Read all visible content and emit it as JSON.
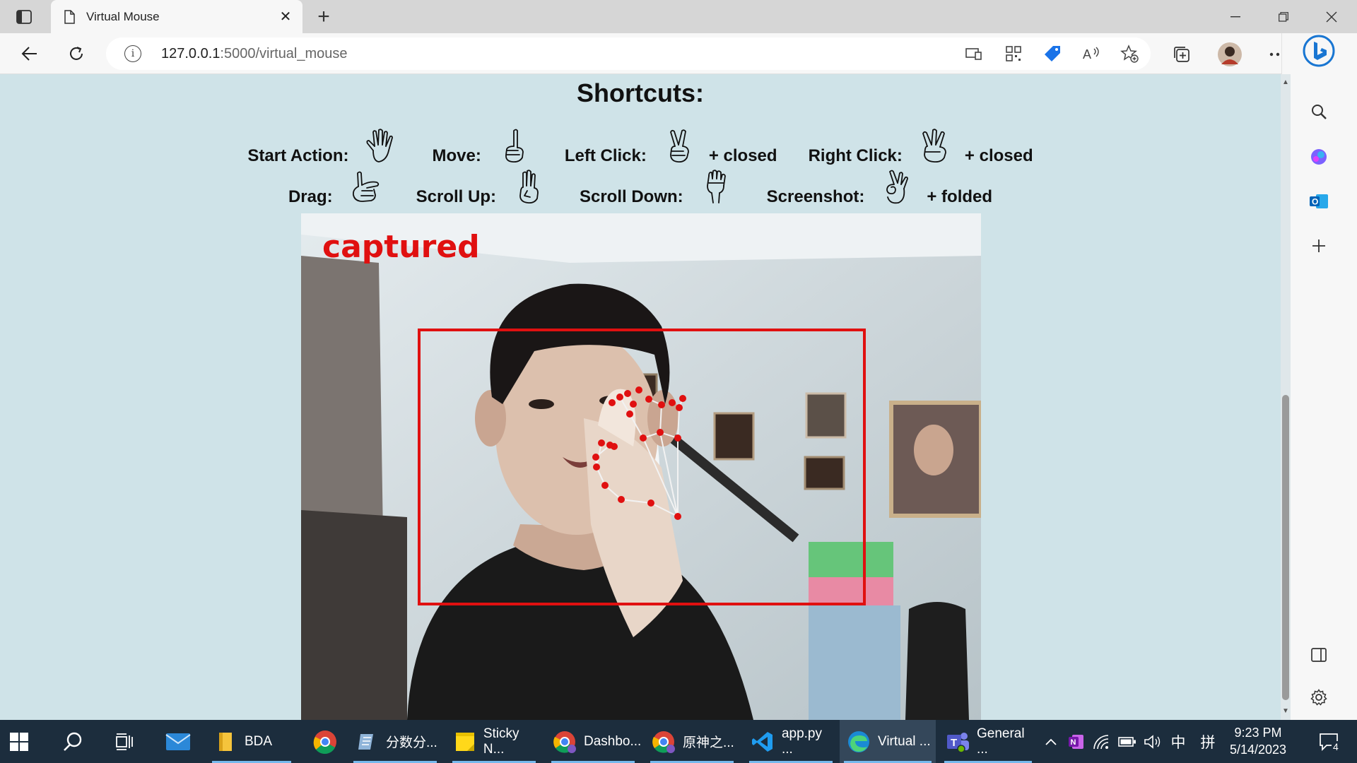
{
  "browser": {
    "tab_title": "Virtual Mouse",
    "url_host": "127.0.0.1",
    "url_path": ":5000/virtual_mouse",
    "colors": {
      "tabbar": "#d6d6d6",
      "toolbar": "#f7f7f7",
      "accent": "#0078d4"
    }
  },
  "page": {
    "heading": "Shortcuts:",
    "background": "#cfe3e8",
    "row1": [
      {
        "label": "Start Action:",
        "icon": "open-palm-icon",
        "suffix": ""
      },
      {
        "label": "Move:",
        "icon": "index-up-icon",
        "suffix": ""
      },
      {
        "label": "Left Click:",
        "icon": "victory-hand-icon",
        "suffix": "+ closed"
      },
      {
        "label": "Right Click:",
        "icon": "three-fingers-icon",
        "suffix": "+ closed"
      }
    ],
    "row2": [
      {
        "label": "Drag:",
        "icon": "pinch-hand-icon",
        "suffix": ""
      },
      {
        "label": "Scroll Up:",
        "icon": "fingers-up-icon",
        "suffix": ""
      },
      {
        "label": "Scroll Down:",
        "icon": "fist-down-icon",
        "suffix": ""
      },
      {
        "label": "Screenshot:",
        "icon": "ok-hand-icon",
        "suffix": "+ folded"
      }
    ],
    "video": {
      "overlay_text": "captured",
      "overlay_color": "#e01010",
      "box_color": "#e01010",
      "landmark_color": "#e01010"
    }
  },
  "taskbar": {
    "items": [
      {
        "label": "",
        "icon": "windows-start-icon"
      },
      {
        "label": "",
        "icon": "search-icon"
      },
      {
        "label": "",
        "icon": "task-view-icon"
      },
      {
        "label": "",
        "icon": "mail-icon"
      },
      {
        "label": "BDA",
        "icon": "folder-icon"
      },
      {
        "label": "",
        "icon": "chrome-icon"
      },
      {
        "label": "分数分...",
        "icon": "notepad-icon"
      },
      {
        "label": "Sticky N...",
        "icon": "sticky-notes-icon"
      },
      {
        "label": "Dashbo...",
        "icon": "chrome-profile-icon"
      },
      {
        "label": "原神之...",
        "icon": "chrome-profile-icon"
      },
      {
        "label": "app.py ...",
        "icon": "vscode-icon"
      },
      {
        "label": "Virtual ...",
        "icon": "edge-icon"
      },
      {
        "label": "General ...",
        "icon": "teams-icon"
      }
    ],
    "tray": {
      "ime1": "中",
      "ime2": "拼",
      "notifications": "4"
    },
    "time": "9:23 PM",
    "date": "5/14/2023"
  }
}
